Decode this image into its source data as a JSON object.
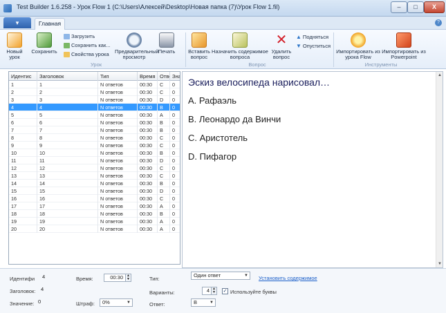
{
  "window": {
    "title": "Test Builder 1.6.258 - Урок Flow 1 (C:\\Users\\Алексей\\Desktop\\Новая папка (7)\\Урок Flow 1.fil)",
    "minimize": "–",
    "maximize": "□",
    "close": "X"
  },
  "tabs": {
    "app_menu": "▾",
    "main": "Главная"
  },
  "ribbon": {
    "groups": {
      "lesson": "Урок",
      "question": "Вопрос",
      "tools": "Инструменты"
    },
    "new_lesson": "Новый урок",
    "save": "Сохранить",
    "load": "Загрузить",
    "save_as": "Сохранить как...",
    "lesson_props": "Свойства урока",
    "preview": "Предварительный просмотр",
    "print": "Печать",
    "insert_question": "Вставить вопрос",
    "assign_content": "Назначить содержимое вопроса",
    "delete_question": "Удалить вопрос",
    "move_up": "Подняться",
    "move_down": "Опуститься",
    "import_flow": "Импортировать из урока Flow",
    "import_ppt": "Импортировать из Powerpoint"
  },
  "table": {
    "columns": [
      "Идентис",
      "Заголовок",
      "Тип",
      "Время",
      "Ответ",
      "Значен"
    ],
    "rows": [
      [
        "1",
        "1",
        "N ответов",
        "00:30",
        "C",
        "0"
      ],
      [
        "2",
        "2",
        "N ответов",
        "00:30",
        "C",
        "0"
      ],
      [
        "3",
        "3",
        "N ответов",
        "00:30",
        "D",
        "0"
      ],
      [
        "4",
        "4",
        "N ответов",
        "00:30",
        "B",
        "0"
      ],
      [
        "5",
        "5",
        "N ответов",
        "00:30",
        "A",
        "0"
      ],
      [
        "6",
        "6",
        "N ответов",
        "00:30",
        "B",
        "0"
      ],
      [
        "7",
        "7",
        "N ответов",
        "00:30",
        "B",
        "0"
      ],
      [
        "8",
        "8",
        "N ответов",
        "00:30",
        "C",
        "0"
      ],
      [
        "9",
        "9",
        "N ответов",
        "00:30",
        "C",
        "0"
      ],
      [
        "10",
        "10",
        "N ответов",
        "00:30",
        "B",
        "0"
      ],
      [
        "11",
        "11",
        "N ответов",
        "00:30",
        "D",
        "0"
      ],
      [
        "12",
        "12",
        "N ответов",
        "00:30",
        "C",
        "0"
      ],
      [
        "13",
        "13",
        "N ответов",
        "00:30",
        "C",
        "0"
      ],
      [
        "14",
        "14",
        "N ответов",
        "00:30",
        "B",
        "0"
      ],
      [
        "15",
        "15",
        "N ответов",
        "00:30",
        "D",
        "0"
      ],
      [
        "16",
        "16",
        "N ответов",
        "00:30",
        "C",
        "0"
      ],
      [
        "17",
        "17",
        "N ответов",
        "00:30",
        "A",
        "0"
      ],
      [
        "18",
        "18",
        "N ответов",
        "00:30",
        "B",
        "0"
      ],
      [
        "19",
        "19",
        "N ответов",
        "00:30",
        "A",
        "0"
      ],
      [
        "20",
        "20",
        "N ответов",
        "00:30",
        "A",
        "0"
      ]
    ],
    "selected_index": 3
  },
  "preview": {
    "question": "Эскиз велосипеда нарисовал…",
    "options": [
      "A. Рафаэль",
      "B. Леонардо да Винчи",
      "C. Аристотель",
      "D. Пифагор"
    ]
  },
  "form": {
    "id_label": "Идентифи",
    "id_value": "4",
    "time_label": "Время:",
    "time_value": "00:30",
    "type_label": "Тип:",
    "type_value": "Один ответ",
    "set_content_link": "Установить содержимое",
    "title_label": "Заголовок:",
    "title_value": "4",
    "variants_label": "Варианты:",
    "variants_value": "4",
    "use_letters_label": "Используйте буквы",
    "use_letters_checked": true,
    "value_label": "Значение:",
    "value_value": "0",
    "penalty_label": "Штраф:",
    "penalty_value": "0%",
    "answer_label": "Ответ:",
    "answer_value": "B"
  },
  "colors": {
    "selection": "#3399ff",
    "question_text": "#1a1e5c",
    "link": "#1b5fc9",
    "ribbon_bg": "#e5eef9"
  },
  "icons": {
    "new_lesson": "new-lesson-icon",
    "save": "save-icon",
    "preview": "magnifier-icon",
    "print": "printer-icon",
    "insert_question": "insert-question-icon",
    "assign_content": "edit-pen-icon",
    "delete_question": "red-x-icon",
    "move_up": "arrow-up-icon",
    "move_down": "arrow-down-icon",
    "import_flow": "flow-icon",
    "import_ppt": "powerpoint-icon"
  }
}
